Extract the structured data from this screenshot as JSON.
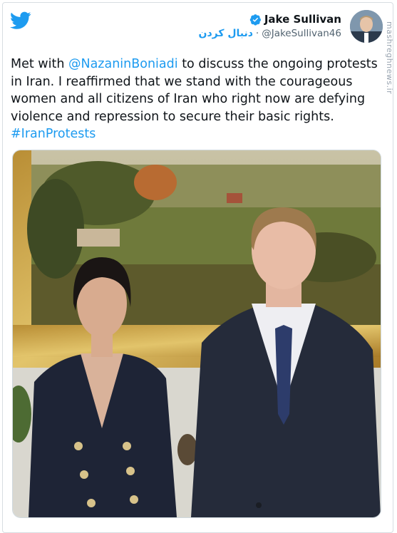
{
  "header": {
    "display_name": "Jake Sullivan",
    "handle": "@JakeSullivan46",
    "separator": "·",
    "follow_label": "دنبال کردن",
    "watermark": "mashreghnews.ir"
  },
  "tweet": {
    "text_prefix": "Met with ",
    "mention": "@NazaninBoniadi",
    "text_body": " to discuss the ongoing protests in Iran.  I reaffirmed that we stand with the courageous women and all citizens of Iran who right now are defying violence and repression to secure their basic rights. ",
    "hashtag": "#IranProtests"
  },
  "icons": {
    "brand": "twitter-bird-icon",
    "verified": "verified-badge-icon"
  },
  "colors": {
    "accent": "#1d9bf0",
    "text": "#0f1419",
    "muted": "#536471"
  }
}
